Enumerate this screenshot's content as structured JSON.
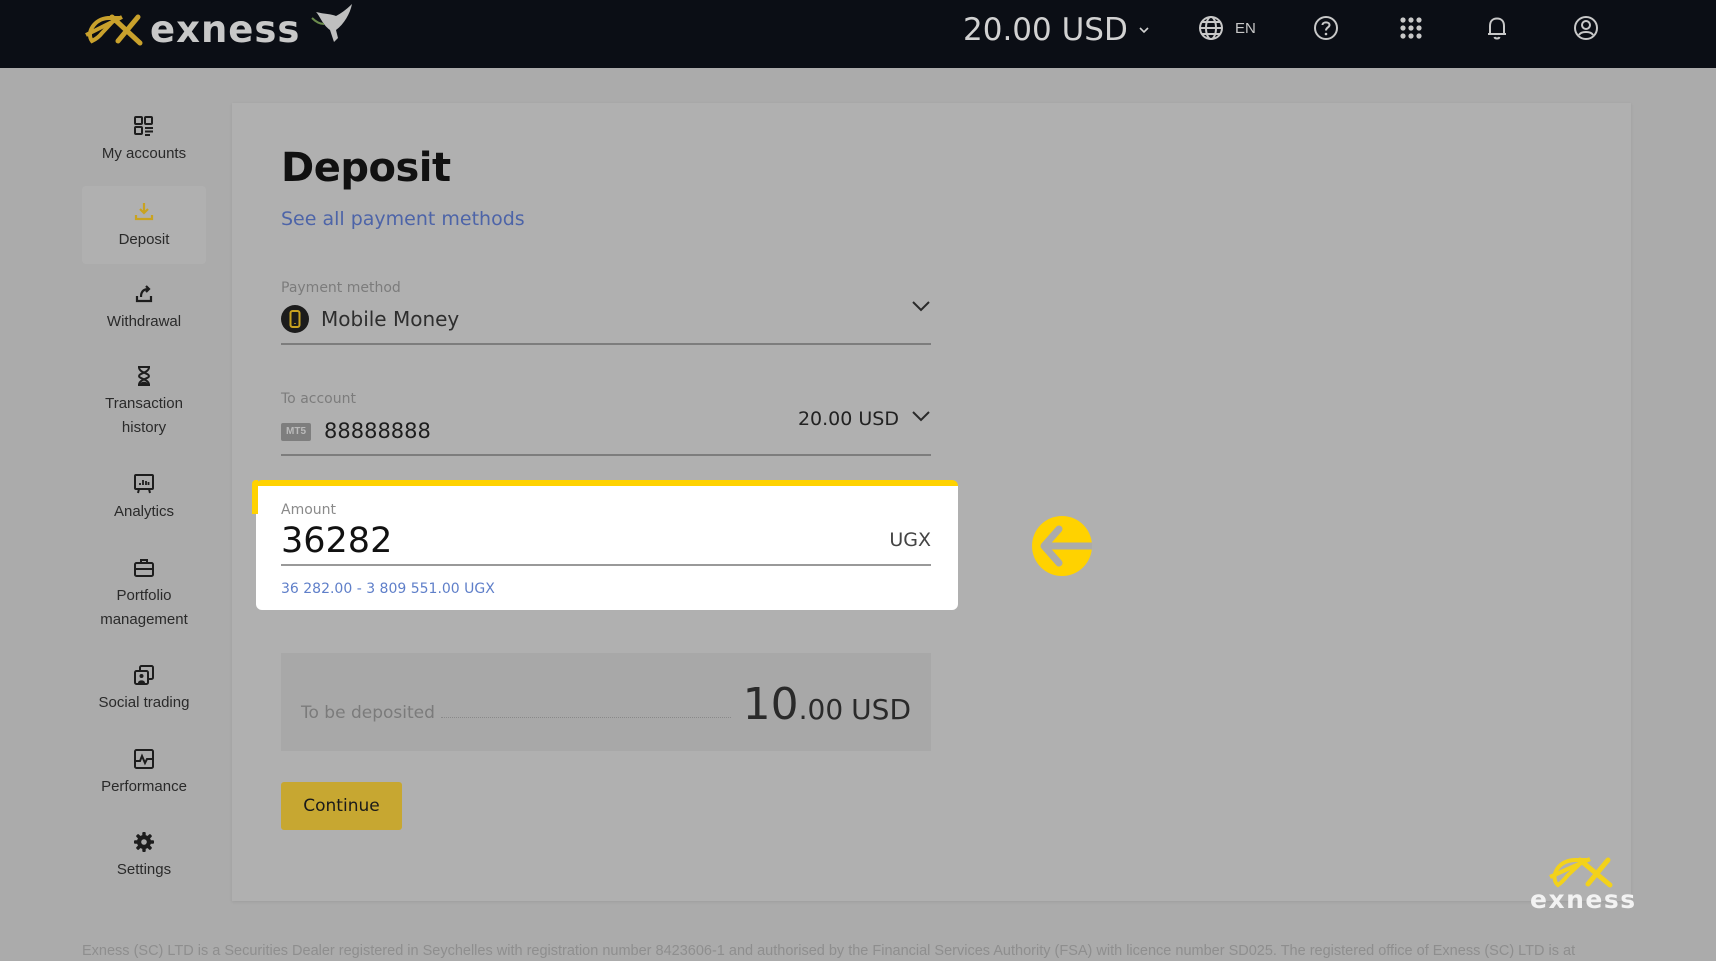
{
  "header": {
    "brand": "exness",
    "balance": "20.00 USD",
    "language": "EN",
    "icons": [
      "globe-icon",
      "help-icon",
      "apps-grid-icon",
      "bell-icon",
      "profile-icon"
    ]
  },
  "sidebar": {
    "items": [
      {
        "label": "My accounts",
        "icon": "accounts-grid-icon",
        "active": false
      },
      {
        "label": "Deposit",
        "icon": "deposit-icon",
        "active": true
      },
      {
        "label": "Withdrawal",
        "icon": "withdrawal-icon",
        "active": false
      },
      {
        "label_line1": "Transaction",
        "label_line2": "history",
        "icon": "hourglass-icon",
        "active": false
      },
      {
        "label": "Analytics",
        "icon": "analytics-board-icon",
        "active": false
      },
      {
        "label_line1": "Portfolio",
        "label_line2": "management",
        "icon": "briefcase-icon",
        "active": false
      },
      {
        "label": "Social trading",
        "icon": "social-trading-icon",
        "active": false
      },
      {
        "label": "Performance",
        "icon": "performance-chart-icon",
        "active": false
      },
      {
        "label": "Settings",
        "icon": "gear-icon",
        "active": false
      }
    ]
  },
  "main": {
    "title": "Deposit",
    "all_methods_link": "See all payment methods",
    "payment_method": {
      "label": "Payment method",
      "value": "Mobile Money"
    },
    "to_account": {
      "label": "To account",
      "platform_badge": "MT5",
      "account_number": "88888888",
      "balance": "20.00 USD"
    },
    "amount": {
      "label": "Amount",
      "value": "36282",
      "currency": "UGX",
      "range": "36 282.00 - 3 809 551.00 UGX"
    },
    "to_be_deposited": {
      "label": "To be deposited",
      "integer": "10",
      "decimals": ".00",
      "currency": "USD"
    },
    "continue_label": "Continue"
  },
  "footer": {
    "text": "Exness (SC) LTD is a Securities Dealer registered in Seychelles with registration number 8423606-1 and authorised by the Financial Services Authority (FSA) with licence number SD025. The registered office of Exness (SC) LTD is at"
  },
  "watermark": {
    "brand": "exness"
  },
  "colors": {
    "accent_yellow": "#ffd200",
    "header_bg": "#0b0e15",
    "link_blue": "#4d64a8",
    "range_blue": "#5f7fc9"
  }
}
